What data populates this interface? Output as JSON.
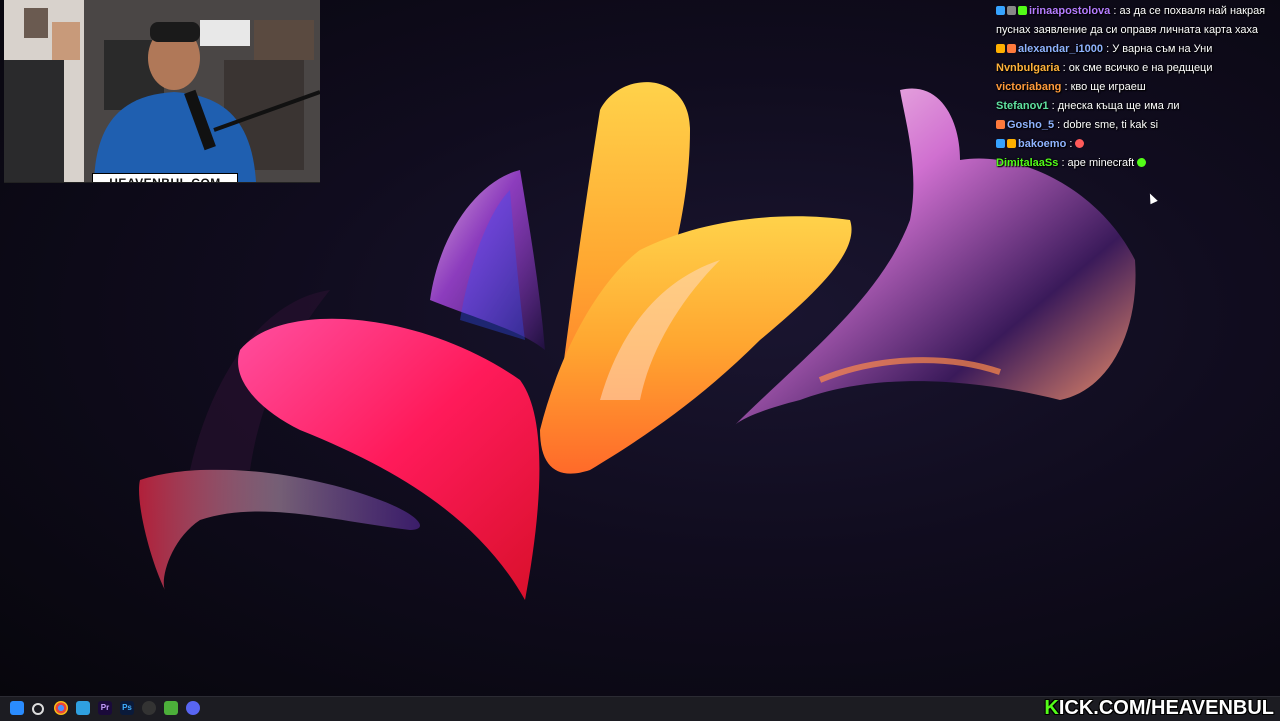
{
  "stream": {
    "webcam_label": "HEAVENBUL.COM",
    "kick_prefix": "K",
    "kick_rest": "ICK.COM/HEAVENBUL"
  },
  "chat": {
    "messages": [
      {
        "user": "irinaapostolova",
        "text": ": аз да се похваля най накрая пуснах заявление да си оправя личната карта хаха",
        "user_color": "#b57cff",
        "badges": [
          "#36a3ff",
          "#888888",
          "#53fc18"
        ]
      },
      {
        "user": "alexandar_i1000",
        "text": ": У варна съм на Уни",
        "user_color": "#8fb3ff",
        "badges": [
          "#ffb000",
          "#ff7a3c"
        ]
      },
      {
        "user": "Nvnbulgaria",
        "text": ": ок сме всичко е на редщеци",
        "user_color": "#ffb23a",
        "badges": []
      },
      {
        "user": "victoriabang",
        "text": ": кво ще играеш",
        "user_color": "#ff9a3c",
        "badges": []
      },
      {
        "user": "Stefanov1",
        "text": ": днеска къща ще има ли",
        "user_color": "#5fe0a0",
        "badges": []
      },
      {
        "user": "Gosho_5",
        "text": ": dobre sme, ti kak si",
        "user_color": "#8fb3ff",
        "badges": [
          "#ff7a3c"
        ]
      },
      {
        "user": "bakoemo",
        "text": ":",
        "user_color": "#8fb3ff",
        "badges": [
          "#36a3ff",
          "#ffb000"
        ],
        "emote": "#ff5a5a"
      },
      {
        "user": "DimitalaaSs",
        "text": ": ape minecraft",
        "user_color": "#53fc18",
        "badges": [],
        "emote": "#53fc18"
      }
    ]
  },
  "taskbar": {
    "icons": [
      "windows-start-icon",
      "search-icon",
      "chrome-icon",
      "file-explorer-icon",
      "premiere-icon",
      "photoshop-icon",
      "obs-icon",
      "minecraft-icon",
      "discord-icon"
    ]
  },
  "colors": {
    "kick_green": "#53fc18",
    "wallpaper_bg": "#0d0a18"
  }
}
